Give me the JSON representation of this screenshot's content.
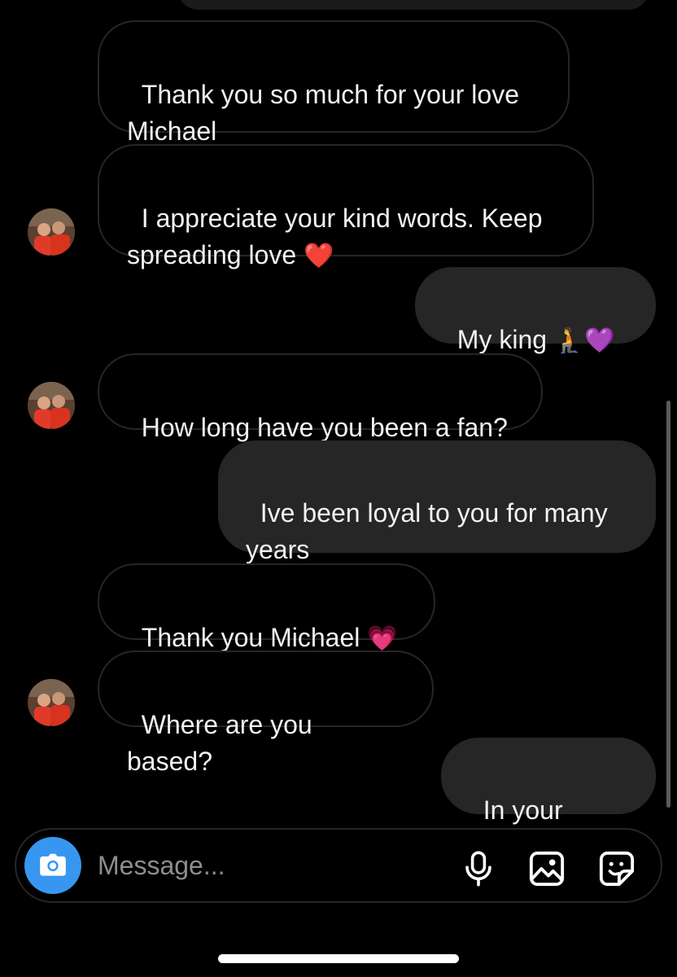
{
  "messages": [
    {
      "id": "m1",
      "side": "in",
      "text": "Thank you so much for your love\nMichael"
    },
    {
      "id": "m2",
      "side": "in",
      "text": "I appreciate your kind words. Keep\nspreading love ",
      "emoji": "❤️"
    },
    {
      "id": "m3",
      "side": "out",
      "text": "My king ",
      "emoji": "🧎💜"
    },
    {
      "id": "m4",
      "side": "in",
      "text": "How long have you been a fan?"
    },
    {
      "id": "m5",
      "side": "out",
      "text": "Ive been loyal to you for many\nyears"
    },
    {
      "id": "m6",
      "side": "in",
      "text": "Thank you Michael ",
      "emoji": "💗"
    },
    {
      "id": "m7",
      "side": "in",
      "text": "Where are you based?"
    },
    {
      "id": "m8",
      "side": "out",
      "text": "In your heart"
    }
  ],
  "composer": {
    "placeholder": "Message...",
    "camera_icon": "camera-icon",
    "mic_icon": "microphone-icon",
    "gallery_icon": "image-icon",
    "sticker_icon": "sticker-icon"
  },
  "colors": {
    "background": "#000000",
    "outgoing_bubble": "#262626",
    "incoming_border": "#262626",
    "camera_button": "#3797f0",
    "placeholder": "#8e8e8e"
  }
}
